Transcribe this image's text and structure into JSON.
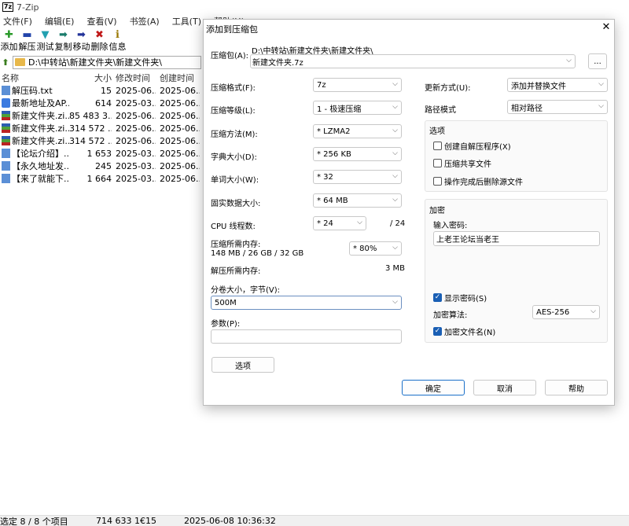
{
  "window": {
    "icon": "7z",
    "title": "7-Zip"
  },
  "menu": [
    "文件(F)",
    "编辑(E)",
    "查看(V)",
    "书签(A)",
    "工具(T)",
    "帮助(H)"
  ],
  "toolbar": [
    {
      "label": "添加",
      "icon": "plus-icon",
      "glyph": "✚",
      "color": "#2a9a2a"
    },
    {
      "label": "解压",
      "icon": "minus-icon",
      "glyph": "▬",
      "color": "#2244aa"
    },
    {
      "label": "测试",
      "icon": "test-icon",
      "glyph": "▼",
      "color": "#22a0b0"
    },
    {
      "label": "复制",
      "icon": "copy-icon",
      "glyph": "➡",
      "color": "#1a7b6b"
    },
    {
      "label": "移动",
      "icon": "move-icon",
      "glyph": "➡",
      "color": "#223399"
    },
    {
      "label": "删除",
      "icon": "delete-icon",
      "glyph": "✖",
      "color": "#c01818"
    },
    {
      "label": "信息",
      "icon": "info-icon",
      "glyph": "ℹ",
      "color": "#997700"
    }
  ],
  "address": {
    "path": "D:\\中转站\\新建文件夹\\新建文件夹\\"
  },
  "filelist": {
    "headers": {
      "name": "名称",
      "size": "大小",
      "modified": "修改时间",
      "created": "创建时间"
    },
    "rows": [
      {
        "type": "txt",
        "name": "解压码.txt",
        "size": "15",
        "modified": "2025-06...",
        "created": "2025-06..."
      },
      {
        "type": "url",
        "name": "最新地址及AP...",
        "size": "614",
        "modified": "2025-03...",
        "created": "2025-06..."
      },
      {
        "type": "zip",
        "name": "新建文件夹.zi...",
        "size": "85 483 3...",
        "modified": "2025-06...",
        "created": "2025-06..."
      },
      {
        "type": "zip",
        "name": "新建文件夹.zi...",
        "size": "314 572 ...",
        "modified": "2025-06...",
        "created": "2025-06..."
      },
      {
        "type": "zip",
        "name": "新建文件夹.zi...",
        "size": "314 572 ...",
        "modified": "2025-06...",
        "created": "2025-06..."
      },
      {
        "type": "txt",
        "name": "【论坛介绍】....",
        "size": "1 653",
        "modified": "2025-03...",
        "created": "2025-06..."
      },
      {
        "type": "txt",
        "name": "【永久地址发...",
        "size": "245",
        "modified": "2025-03...",
        "created": "2025-06..."
      },
      {
        "type": "txt",
        "name": "【来了就能下...",
        "size": "1 664",
        "modified": "2025-03...",
        "created": "2025-06..."
      }
    ]
  },
  "status": {
    "selected": "选定 8 / 8 个项目",
    "size": "714 633 1€15",
    "date": "2025-06-08 10:36:32"
  },
  "dialog": {
    "title": "添加到压缩包",
    "archive_label": "压缩包(A):",
    "archive_path": "D:\\中转站\\新建文件夹\\新建文件夹\\",
    "archive_name": "新建文件夹.7z",
    "browse": "...",
    "format_label": "压缩格式(F):",
    "format": "7z",
    "level_label": "压缩等级(L):",
    "level": "1 - 极速压缩",
    "method_label": "压缩方法(M):",
    "method": "* LZMA2",
    "dict_label": "字典大小(D):",
    "dict": "* 256 KB",
    "word_label": "单词大小(W):",
    "word": "* 32",
    "solid_label": "固实数据大小:",
    "solid": "* 64 MB",
    "threads_label": "CPU 线程数:",
    "threads": "* 24",
    "threads_max": "/ 24",
    "mem_label": "压缩所需内存:",
    "mem_info": "148 MB / 26 GB / 32 GB",
    "mem_percent": "* 80%",
    "decomp_label": "解压所需内存:",
    "decomp_value": "3 MB",
    "volume_label": "分卷大小，字节(V):",
    "volume": "500M",
    "params_label": "参数(P):",
    "params": "",
    "options_button": "选项",
    "update_label": "更新方式(U):",
    "update": "添加并替换文件",
    "pathmode_label": "路径模式",
    "pathmode": "相对路径",
    "options_group": "选项",
    "opt_sfx": "创建自解压程序(X)",
    "opt_shared": "压缩共享文件",
    "opt_delete": "操作完成后删除源文件",
    "encryption_group": "加密",
    "password_label": "输入密码:",
    "password": "上老王论坛当老王",
    "show_password": "显示密码(S)",
    "enc_method_label": "加密算法:",
    "enc_method": "AES-256",
    "encrypt_names": "加密文件名(N)",
    "ok": "确定",
    "cancel": "取消",
    "help": "帮助"
  }
}
